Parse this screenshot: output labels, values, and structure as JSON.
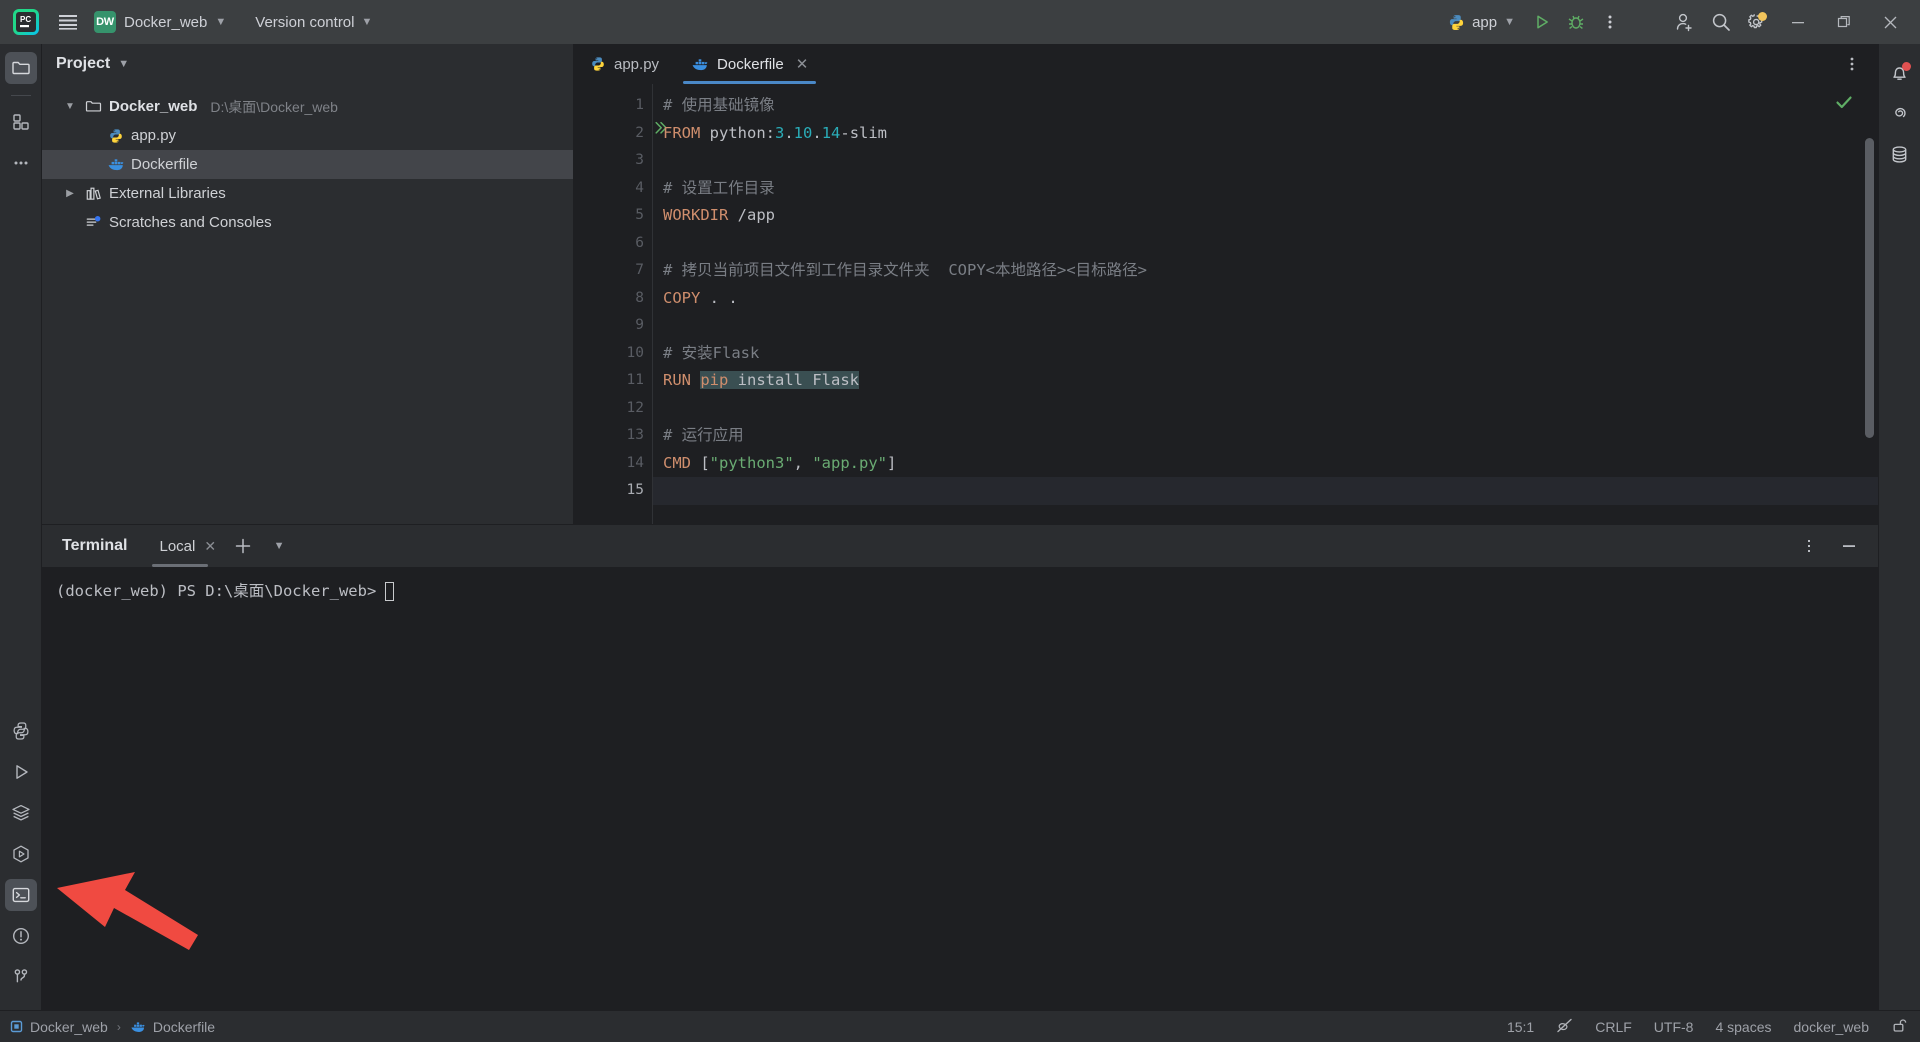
{
  "window": {
    "app": "PyCharm",
    "project_badge": "DW",
    "project_name": "Docker_web",
    "version_control": "Version control",
    "hamburger_icon": "hamburger-menu-icon",
    "minimize_label": "—",
    "maximize_label": "❐",
    "close_label": "✕"
  },
  "toolbar": {
    "run_config_name": "app",
    "run_config_icon": "python-icon",
    "run_icon": "run-triangle-icon",
    "debug_icon": "debug-bug-icon",
    "more_icon": "more-vertical-icon",
    "account_icon": "add-account-icon",
    "search_icon": "search-icon",
    "settings_icon": "settings-gear-icon",
    "settings_badge_color": "#f2c55c"
  },
  "left_rail": {
    "top_items": [
      {
        "name": "project-tool-window",
        "icon": "folder-icon",
        "active": true
      },
      {
        "name": "commit-tool-window",
        "icon": "grid-squares-icon",
        "active": false
      },
      {
        "name": "more-tool-windows",
        "icon": "ellipsis-icon",
        "active": false
      }
    ],
    "bottom_items": [
      {
        "name": "python-packages",
        "icon": "python-icon",
        "active": false
      },
      {
        "name": "run-tool-window",
        "icon": "run-triangle-icon",
        "active": false
      },
      {
        "name": "services-tool-window",
        "icon": "layers-icon",
        "active": false
      },
      {
        "name": "python-console",
        "icon": "hex-run-icon",
        "active": false
      },
      {
        "name": "terminal-tool-window",
        "icon": "terminal-icon",
        "active": true
      },
      {
        "name": "problems-tool-window",
        "icon": "warning-circle-icon",
        "active": false
      },
      {
        "name": "version-control-tool-window",
        "icon": "branch-icon",
        "active": false
      }
    ]
  },
  "right_rail": {
    "items": [
      {
        "name": "notifications",
        "icon": "bell-icon",
        "badge": "#e05151"
      },
      {
        "name": "ai-assistant",
        "icon": "spiral-icon",
        "badge": ""
      },
      {
        "name": "database",
        "icon": "database-icon",
        "badge": ""
      }
    ]
  },
  "project_panel": {
    "title": "Project",
    "chevron_icon": "chevron-down-icon",
    "tree": [
      {
        "label": "Docker_web",
        "path": "D:\\桌面\\Docker_web",
        "icon": "folder-icon",
        "arrow": "chevron-down-icon",
        "depth": 0,
        "bold": true,
        "selected": false
      },
      {
        "label": "app.py",
        "path": "",
        "icon": "python-file-icon",
        "arrow": "",
        "depth": 1,
        "bold": false,
        "selected": false
      },
      {
        "label": "Dockerfile",
        "path": "",
        "icon": "docker-file-icon",
        "arrow": "",
        "depth": 1,
        "bold": false,
        "selected": true
      },
      {
        "label": "External Libraries",
        "path": "",
        "icon": "library-icon",
        "arrow": "chevron-right-icon",
        "depth": 0,
        "bold": false,
        "selected": false
      },
      {
        "label": "Scratches and Consoles",
        "path": "",
        "icon": "scratches-icon",
        "arrow": "",
        "depth": 0,
        "bold": false,
        "selected": false
      }
    ]
  },
  "editor": {
    "tabs": [
      {
        "label": "app.py",
        "icon": "python-file-icon",
        "active": false,
        "closable": false
      },
      {
        "label": "Dockerfile",
        "icon": "docker-file-icon",
        "active": true,
        "closable": true
      }
    ],
    "options_icon": "more-vertical-icon",
    "inspection_status_icon": "checkmark-icon",
    "line_count": 15,
    "current_line": 15,
    "gutter_run_line": 2,
    "gutter_run_icon": "double-chevron-run-icon",
    "lines": [
      {
        "n": 1,
        "tokens": [
          {
            "t": "# 使用基础镜像",
            "c": "cm"
          }
        ]
      },
      {
        "n": 2,
        "tokens": [
          {
            "t": "FROM",
            "c": "kw"
          },
          {
            "t": " python:",
            "c": "txt"
          },
          {
            "t": "3",
            "c": "num"
          },
          {
            "t": ".",
            "c": "txt"
          },
          {
            "t": "10",
            "c": "num"
          },
          {
            "t": ".",
            "c": "txt"
          },
          {
            "t": "14",
            "c": "num"
          },
          {
            "t": "-slim",
            "c": "txt"
          }
        ]
      },
      {
        "n": 3,
        "tokens": []
      },
      {
        "n": 4,
        "tokens": [
          {
            "t": "# 设置工作目录",
            "c": "cm"
          }
        ]
      },
      {
        "n": 5,
        "tokens": [
          {
            "t": "WORKDIR",
            "c": "kw"
          },
          {
            "t": " /app",
            "c": "txt"
          }
        ]
      },
      {
        "n": 6,
        "tokens": []
      },
      {
        "n": 7,
        "tokens": [
          {
            "t": "# 拷贝当前项目文件到工作目录文件夹  COPY<本地路径><目标路径>",
            "c": "cm"
          }
        ]
      },
      {
        "n": 8,
        "tokens": [
          {
            "t": "COPY",
            "c": "kw"
          },
          {
            "t": " . .",
            "c": "txt"
          }
        ]
      },
      {
        "n": 9,
        "tokens": []
      },
      {
        "n": 10,
        "tokens": [
          {
            "t": "# 安装Flask",
            "c": "cm"
          }
        ]
      },
      {
        "n": 11,
        "tokens": [
          {
            "t": "RUN",
            "c": "kw"
          },
          {
            "t": " ",
            "c": "txt"
          },
          {
            "t": "pip",
            "c": "kw sel"
          },
          {
            "t": " install Flask",
            "c": "txt sel"
          }
        ]
      },
      {
        "n": 12,
        "tokens": []
      },
      {
        "n": 13,
        "tokens": [
          {
            "t": "# 运行应用",
            "c": "cm"
          }
        ]
      },
      {
        "n": 14,
        "tokens": [
          {
            "t": "CMD",
            "c": "kw"
          },
          {
            "t": " [",
            "c": "txt"
          },
          {
            "t": "\"python3\"",
            "c": "str"
          },
          {
            "t": ", ",
            "c": "txt"
          },
          {
            "t": "\"app.py\"",
            "c": "str"
          },
          {
            "t": "]",
            "c": "txt"
          }
        ]
      },
      {
        "n": 15,
        "tokens": []
      }
    ]
  },
  "terminal": {
    "title": "Terminal",
    "tab_label": "Local",
    "tab_close_icon": "close-icon",
    "add_icon": "plus-icon",
    "dropdown_icon": "chevron-down-icon",
    "options_icon": "more-vertical-icon",
    "minimize_icon": "minimize-icon",
    "prompt": "(docker_web) PS D:\\桌面\\Docker_web>"
  },
  "status_bar": {
    "breadcrumb": [
      {
        "label": "Docker_web",
        "icon": "module-icon"
      },
      {
        "label": "Dockerfile",
        "icon": "docker-file-icon"
      }
    ],
    "separator": "›",
    "caret_position": "15:1",
    "indexing_icon": "no-access-icon",
    "line_separator": "CRLF",
    "encoding": "UTF-8",
    "indent": "4 spaces",
    "interpreter": "docker_web",
    "lock_icon": "unlocked-icon"
  },
  "annotation": {
    "arrow_color": "#f04a41",
    "target": "terminal-tool-window"
  }
}
